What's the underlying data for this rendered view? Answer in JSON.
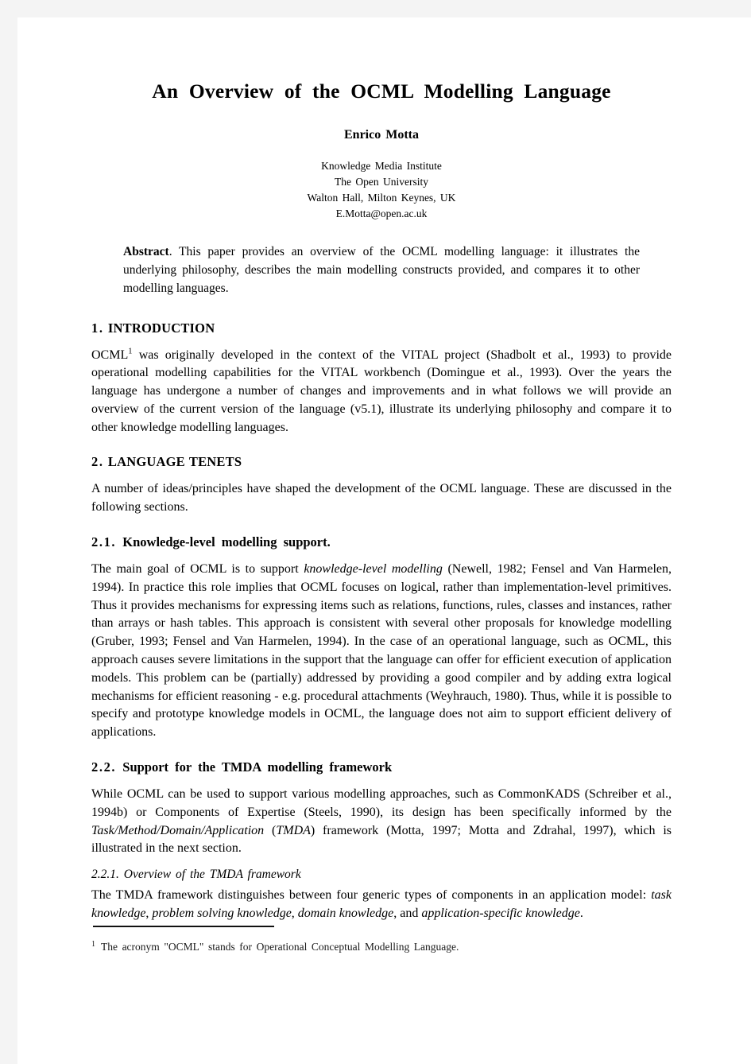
{
  "paper": {
    "title": "An Overview of the OCML Modelling Language",
    "author": "Enrico Motta",
    "affiliation": {
      "institute": "Knowledge Media Institute",
      "university": "The Open University",
      "address": "Walton Hall, Milton Keynes, UK",
      "email": "E.Motta@open.ac.uk"
    },
    "abstract": {
      "label": "Abstract",
      "text": ". This paper provides an overview of the OCML modelling language: it illustrates the underlying philosophy, describes the main modelling constructs provided, and compares it to other modelling languages."
    },
    "sections": [
      {
        "number": "1.",
        "heading": "INTRODUCTION",
        "paragraphs": [
          {
            "lead": "OCML",
            "footnote_marker": "1",
            "rest": " was originally developed in the context of the VITAL project (Shadbolt et al., 1993) to provide operational modelling capabilities for the VITAL workbench (Domingue et al., 1993). Over the years the language has undergone a number of changes and improvements and in what follows we will provide an overview of the current version of the language (v5.1), illustrate its underlying philosophy and compare it to other knowledge modelling languages."
          }
        ]
      },
      {
        "number": "2.",
        "heading": "LANGUAGE TENETS",
        "intro": "A number of ideas/principles have shaped the development of the OCML language.  These are discussed in the following sections.",
        "subsections": [
          {
            "number": "2.1.",
            "heading": "Knowledge-level modelling support.",
            "part1": "The main goal of OCML is to support ",
            "italic1": "knowledge-level modelling",
            "part2": " (Newell, 1982; Fensel and Van Harmelen, 1994).  In practice this role implies that OCML focuses on logical, rather than implementation-level primitives.  Thus it provides mechanisms for expressing items such as relations, functions, rules, classes and instances, rather than arrays or hash tables.  This approach is consistent with several other proposals for knowledge modelling (Gruber, 1993; Fensel and Van Harmelen, 1994).  In the case of an operational language, such as OCML, this approach causes severe limitations in the support that the language can offer for efficient execution of application models.  This problem can be (partially) addressed by providing a good compiler and by adding extra logical mechanisms for efficient reasoning - e.g. procedural attachments (Weyhrauch, 1980).  Thus, while it is possible to specify and prototype knowledge models in OCML, the language does not aim to support efficient delivery of applications."
          },
          {
            "number": "2.2.",
            "heading": "Support for the TMDA modelling framework",
            "part1": "While OCML can be used to support various modelling approaches, such as CommonKADS (Schreiber et al., 1994b) or Components of Expertise (Steels, 1990), its design has been specifically informed by the ",
            "italic1": "Task/Method/Domain/Application",
            "part2": " (",
            "italic2": "TMDA",
            "part3": ") framework (Motta, 1997; Motta and Zdrahal, 1997), which is illustrated in the next section.",
            "subsubsections": [
              {
                "number": "2.2.1.",
                "heading": "Overview of the TMDA framework",
                "part1": "The TMDA framework distinguishes between four generic types of components in an application model: ",
                "italic1": "task knowledge",
                "part2": ", ",
                "italic2": "problem solving knowledge",
                "part3": ", ",
                "italic3": "domain knowledge",
                "part4": ", and ",
                "italic4": "application-specific knowledge",
                "part5": "."
              }
            ]
          }
        ]
      }
    ],
    "footnote": {
      "marker": "1",
      "text": "The acronym \"OCML\" stands for Operational Conceptual Modelling Language."
    }
  }
}
